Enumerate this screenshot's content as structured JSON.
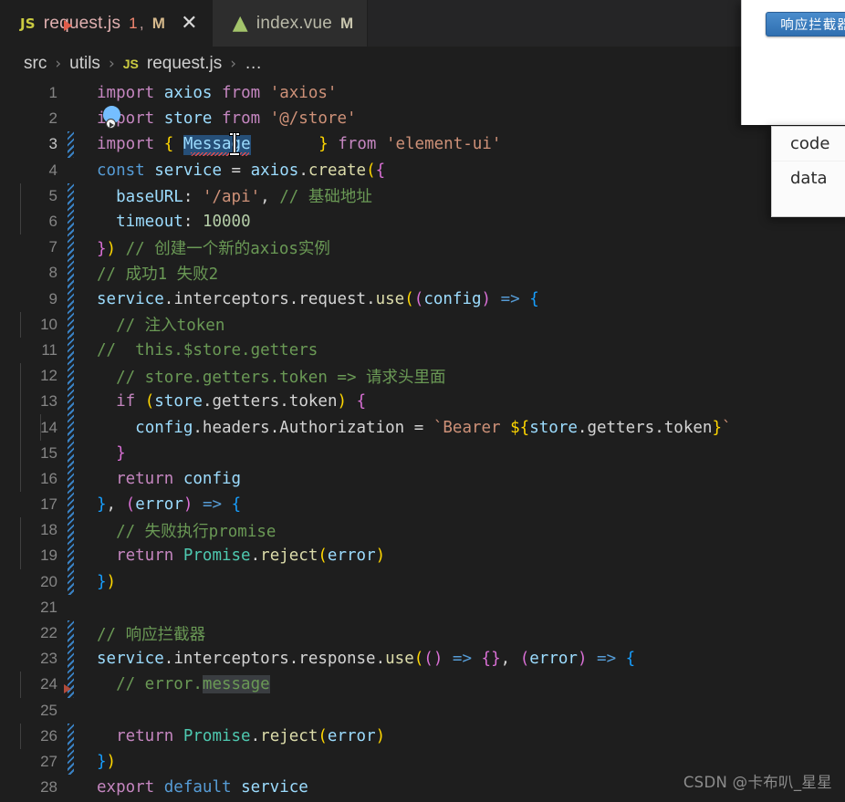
{
  "window": {
    "app": "Visual Studio Code",
    "theme_background": "#1e1e1e"
  },
  "tabs": [
    {
      "icon": "js-file-icon",
      "icon_label": "JS",
      "filename": "request.js",
      "error_count": "1",
      "separator": ",",
      "dirty_marker": "M",
      "close_label": "✕",
      "active": true
    },
    {
      "icon": "vue-file-icon",
      "icon_label": "Ⓥ",
      "filename": "index.vue",
      "dirty_marker": "M",
      "active": false
    }
  ],
  "breadcrumb": {
    "items": [
      "src",
      "utils",
      "request.js",
      "…"
    ],
    "file_icon_label": "JS",
    "separator": "›"
  },
  "editor": {
    "language": "javascript",
    "first_line": 1,
    "lines": [
      {
        "n": "1",
        "modified": false,
        "text": "import axios from 'axios'"
      },
      {
        "n": "2",
        "modified": false,
        "text": "import store from '@/store'"
      },
      {
        "n": "3",
        "modified": true,
        "text": "import { Message } from 'element-ui'"
      },
      {
        "n": "4",
        "modified": false,
        "text": "const service = axios.create({"
      },
      {
        "n": "5",
        "modified": true,
        "text": "  baseURL: '/api', // 基础地址"
      },
      {
        "n": "6",
        "modified": true,
        "text": "  timeout: 10000"
      },
      {
        "n": "7",
        "modified": true,
        "text": "}) // 创建一个新的axios实例"
      },
      {
        "n": "8",
        "modified": true,
        "text": "// 成功1 失败2"
      },
      {
        "n": "9",
        "modified": true,
        "text": "service.interceptors.request.use((config) => {"
      },
      {
        "n": "10",
        "modified": true,
        "text": "  // 注入token"
      },
      {
        "n": "11",
        "modified": true,
        "text": "//  this.$store.getters"
      },
      {
        "n": "12",
        "modified": true,
        "text": "  // store.getters.token => 请求头里面"
      },
      {
        "n": "13",
        "modified": true,
        "text": "  if (store.getters.token) {"
      },
      {
        "n": "14",
        "modified": true,
        "text": "    config.headers.Authorization = `Bearer ${store.getters.token}`"
      },
      {
        "n": "15",
        "modified": true,
        "text": "  }"
      },
      {
        "n": "16",
        "modified": true,
        "text": "  return config"
      },
      {
        "n": "17",
        "modified": true,
        "text": "}, (error) => {"
      },
      {
        "n": "18",
        "modified": true,
        "text": "  // 失败执行promise"
      },
      {
        "n": "19",
        "modified": true,
        "text": "  return Promise.reject(error)"
      },
      {
        "n": "20",
        "modified": true,
        "text": "})"
      },
      {
        "n": "21",
        "modified": false,
        "text": ""
      },
      {
        "n": "22",
        "modified": true,
        "text": "// 响应拦截器"
      },
      {
        "n": "23",
        "modified": true,
        "text": "service.interceptors.response.use(() => {}, (error) => {"
      },
      {
        "n": "24",
        "modified": true,
        "text": "  // error.message"
      },
      {
        "n": "25",
        "modified": false,
        "text": ""
      },
      {
        "n": "26",
        "modified": true,
        "text": "  return Promise.reject(error)"
      },
      {
        "n": "27",
        "modified": true,
        "text": "})"
      },
      {
        "n": "28",
        "modified": false,
        "text": "export default service"
      }
    ],
    "selection": {
      "line": 3,
      "text": "Message",
      "has_error_squiggle": true
    },
    "word_highlight": {
      "line": 24,
      "text": "message"
    },
    "code_action_icon": "lightbulb-icon",
    "debug_marker_icon": "breakpoint-arrow-icon"
  },
  "overlay": {
    "button_label": "响应拦截器",
    "rows": [
      "code",
      "data"
    ]
  },
  "watermark": {
    "text": "CSDN @卡布叭_星星"
  },
  "colors": {
    "editor_bg": "#1e1e1e",
    "tab_active_bg": "#1e1e1e",
    "tab_inactive_bg": "#2d2d2d",
    "tabbar_bg": "#252526",
    "selection": "#264f78",
    "error": "#f14c4c",
    "comment": "#6a9955",
    "string": "#ce9178",
    "keyword": "#c586c0",
    "variable": "#9cdcfe",
    "accent_button": "#2f6fb0",
    "modified_gutter": "#3a82c4"
  }
}
